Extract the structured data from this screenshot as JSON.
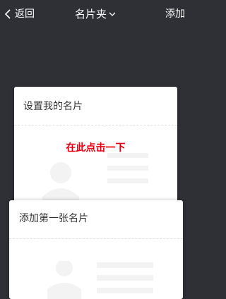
{
  "nav": {
    "back_label": "返回",
    "title": "名片夹",
    "add_label": "添加"
  },
  "card_setup": {
    "title": "设置我的名片",
    "hint": "在此点击一下"
  },
  "card_add": {
    "title": "添加第一张名片"
  },
  "colors": {
    "background": "#2e3036",
    "card": "#ffffff",
    "hint": "#e60012",
    "placeholder": "#f3f3f3"
  }
}
